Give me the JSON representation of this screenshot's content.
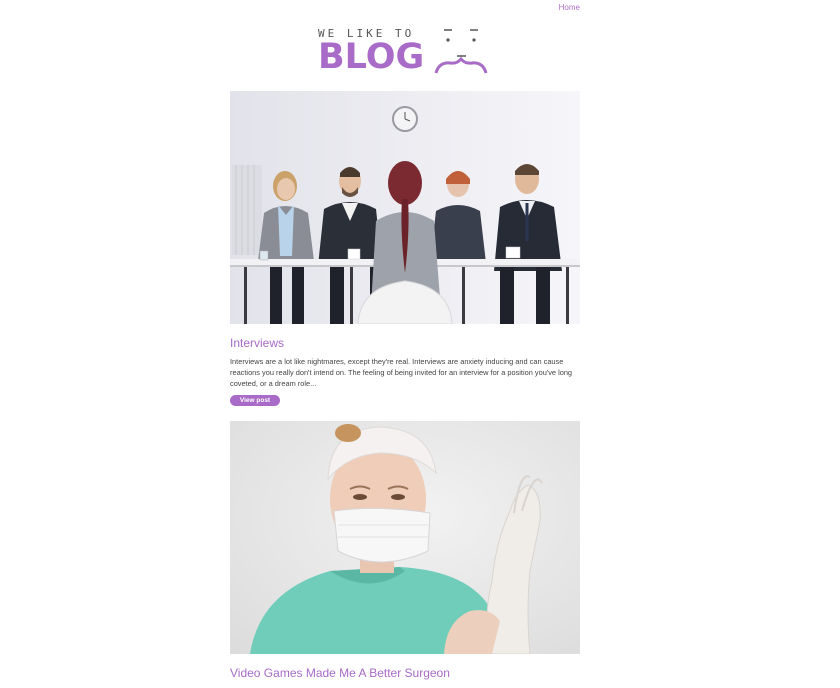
{
  "nav": {
    "home_label": "Home"
  },
  "logo": {
    "tagline": "WE LIKE TO",
    "word": "BLOG"
  },
  "posts": [
    {
      "title": "Interviews",
      "excerpt": "Interviews are a lot like nightmares, except they're real. Interviews are anxiety inducing and can cause reactions you really don't intend on. The feeling of being invited for an interview for a position you've long coveted, or a dream role...",
      "button_label": "View post"
    },
    {
      "title": "Video Games Made Me A Better Surgeon"
    }
  ],
  "colors": {
    "accent": "#a86bc7"
  }
}
